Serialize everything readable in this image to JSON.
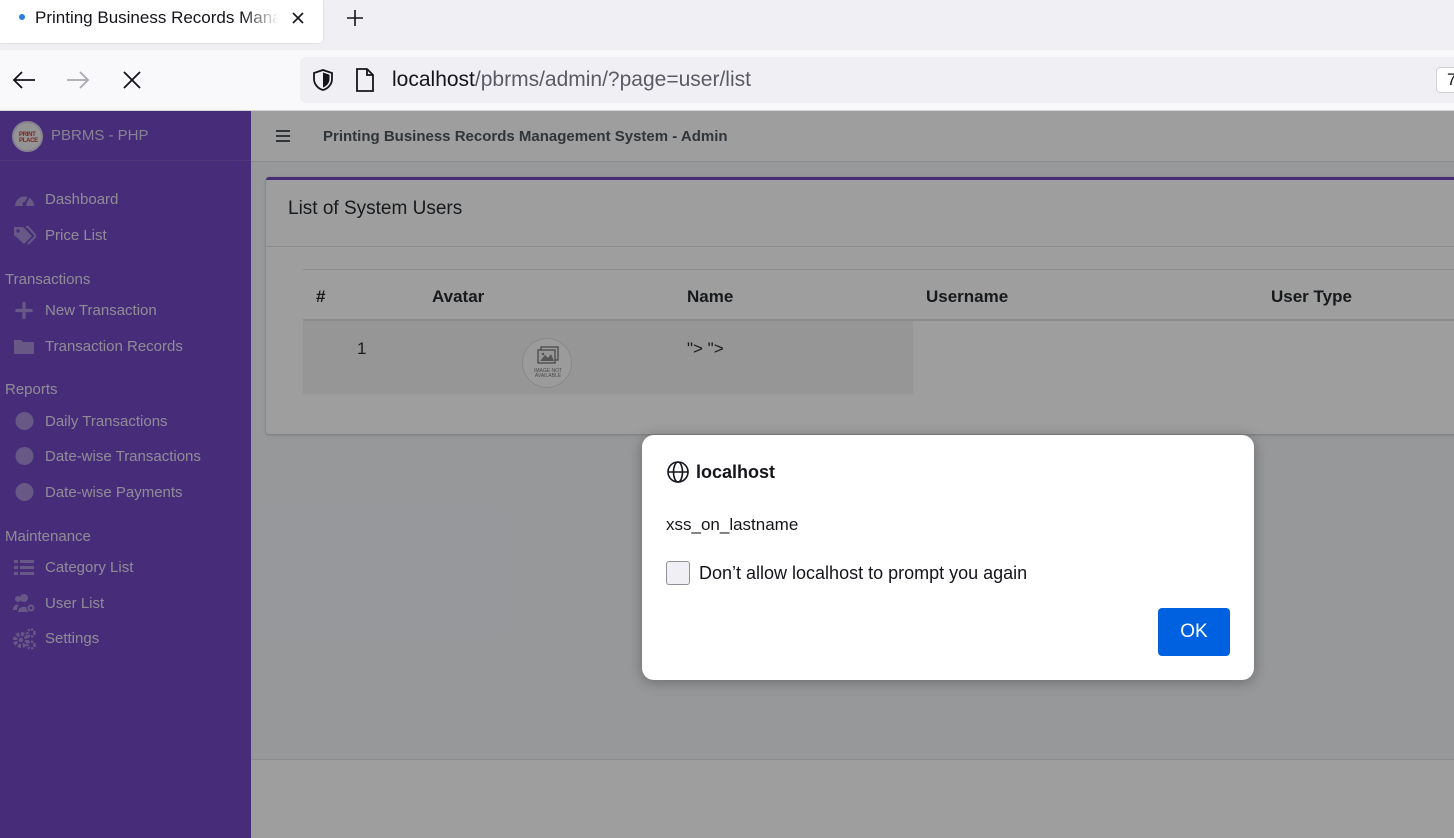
{
  "browser": {
    "tab_title": "Printing Business Records Management System - Admin",
    "url_host": "localhost",
    "url_path": "/pbrms/admin/?page=user/list",
    "toolbar_right_partial": "7"
  },
  "app": {
    "brand": "PBRMS - PHP",
    "logo_text": "PRINT PLACE",
    "header_title": "Printing Business Records Management System - Admin"
  },
  "sidebar": {
    "dashboard": "Dashboard",
    "price_list": "Price List",
    "section_transactions": "Transactions",
    "new_transaction": "New Transaction",
    "transaction_records": "Transaction Records",
    "section_reports": "Reports",
    "daily_transactions": "Daily Transactions",
    "datewise_transactions": "Date-wise Transactions",
    "datewise_payments": "Date-wise Payments",
    "section_maintenance": "Maintenance",
    "category_list": "Category List",
    "user_list": "User List",
    "settings": "Settings"
  },
  "card": {
    "title": "List of System Users",
    "columns": [
      "#",
      "Avatar",
      "Name",
      "Username",
      "User Type"
    ],
    "rows": [
      {
        "num": "1",
        "avatar_caption": "IMAGE NOT AVAILABLE",
        "name": "\"> \">",
        "username": "",
        "user_type": ""
      }
    ]
  },
  "dialog": {
    "origin": "localhost",
    "message": "xss_on_lastname",
    "checkbox_label": "Don’t allow localhost to prompt you again",
    "checkbox_checked": false,
    "ok_label": "OK"
  },
  "colors": {
    "sidebar": "#6f42c1",
    "accent": "#0061e0"
  }
}
